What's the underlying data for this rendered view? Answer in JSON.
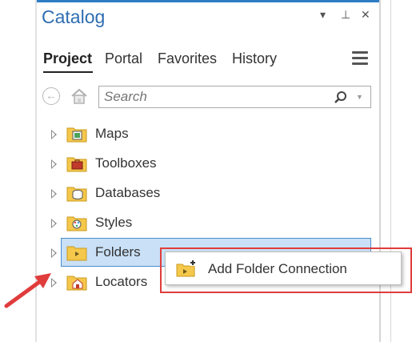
{
  "pane": {
    "title": "Catalog",
    "title_buttons": {
      "dropdown": "▾",
      "pin": "⊥",
      "close": "✕"
    }
  },
  "tabs": [
    {
      "label": "Project",
      "active": true
    },
    {
      "label": "Portal",
      "active": false
    },
    {
      "label": "Favorites",
      "active": false
    },
    {
      "label": "History",
      "active": false
    }
  ],
  "search": {
    "placeholder": "Search"
  },
  "tree": [
    {
      "label": "Maps",
      "icon": "maps-folder-icon"
    },
    {
      "label": "Toolboxes",
      "icon": "toolbox-folder-icon"
    },
    {
      "label": "Databases",
      "icon": "database-folder-icon"
    },
    {
      "label": "Styles",
      "icon": "styles-folder-icon"
    },
    {
      "label": "Folders",
      "icon": "folders-folder-icon",
      "selected": true
    },
    {
      "label": "Locators",
      "icon": "locator-folder-icon"
    }
  ],
  "context_menu": {
    "items": [
      {
        "label": "Add Folder Connection",
        "icon": "add-folder-connection-icon"
      }
    ]
  },
  "colors": {
    "accent": "#2e6db2",
    "selection": "#c9e0f6",
    "callout": "#e03c3c",
    "folder": "#f5c84c"
  }
}
